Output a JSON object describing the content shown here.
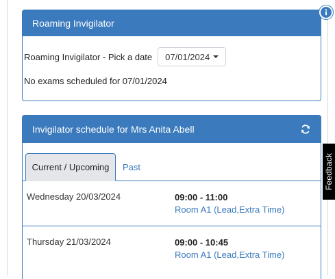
{
  "roaming_panel": {
    "title": "Roaming Invigilator",
    "pick_label": "Roaming Invigilator - Pick a date",
    "date_value": "07/01/2024",
    "no_exams_text": "No exams scheduled for 07/01/2024"
  },
  "schedule_panel": {
    "title": "Invigilator schedule for Mrs Anita Abell",
    "refresh_icon": "refresh-icon",
    "tabs": [
      {
        "label": "Current / Upcoming",
        "active": true
      },
      {
        "label": "Past",
        "active": false
      }
    ],
    "rows": [
      {
        "date": "Wednesday 20/03/2024",
        "time": "09:00 - 11:00",
        "room": "Room A1 (Lead,Extra Time)"
      },
      {
        "date": "Thursday 21/03/2024",
        "time": "09:00 - 10:45",
        "room": "Room A1 (Lead,Extra Time)"
      }
    ]
  },
  "info_badge": {
    "icon": "info-icon",
    "glyph": "i"
  },
  "feedback_tab": {
    "label": "Feedback"
  },
  "colors": {
    "accent": "#3a7abd",
    "tab_active_bg": "#e4e6e9",
    "feedback_bg": "#000000"
  }
}
